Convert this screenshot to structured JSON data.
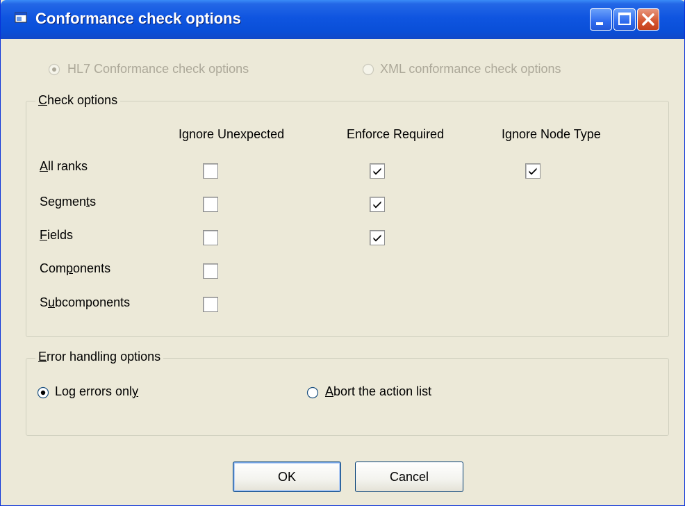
{
  "window": {
    "title": "Conformance check options"
  },
  "mode": {
    "hl7_label": "HL7 Conformance check options",
    "xml_label": "XML conformance check options"
  },
  "check_options": {
    "title": "Check options",
    "columns": [
      "Ignore Unexpected",
      "Enforce Required",
      "Ignore Node Type"
    ],
    "rows": [
      {
        "label": "All ranks",
        "ignore_unexpected": false,
        "enforce_required": true,
        "ignore_node_type": true
      },
      {
        "label": "Segments",
        "ignore_unexpected": false,
        "enforce_required": true
      },
      {
        "label": "Fields",
        "ignore_unexpected": false,
        "enforce_required": true
      },
      {
        "label": "Components",
        "ignore_unexpected": false
      },
      {
        "label": "Subcomponents",
        "ignore_unexpected": false
      }
    ]
  },
  "error_handling": {
    "title": "Error handling options",
    "log_label": "Log errors only",
    "abort_label": "Abort the action list",
    "selected": "log"
  },
  "buttons": {
    "ok": "OK",
    "cancel": "Cancel"
  },
  "colors": {
    "titlebar": "#0A4FD8",
    "background": "#ECE9D8",
    "disabled_text": "#ACA899"
  }
}
